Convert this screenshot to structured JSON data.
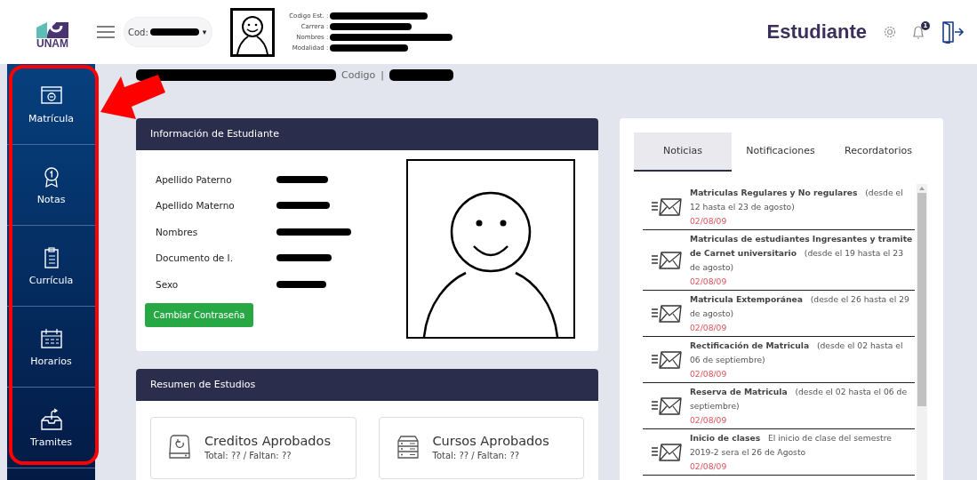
{
  "header": {
    "logo_text": "UNAM",
    "cod_label": "Cod:",
    "cod_caret": "▾",
    "student_fields": [
      "Codigo Est. :",
      "Carrera :",
      "Nombres :",
      "Modalidad :"
    ],
    "role": "Estudiante",
    "notification_count": "1"
  },
  "sidebar": {
    "items": [
      {
        "label": "Matrícula"
      },
      {
        "label": "Notas"
      },
      {
        "label": "Currícula"
      },
      {
        "label": "Horarios"
      },
      {
        "label": "Tramites"
      }
    ]
  },
  "breadcrumb": {
    "code_label": "Codigo",
    "separator": "|"
  },
  "student_card": {
    "title": "Información de Estudiante",
    "fields": [
      "Apellido Paterno",
      "Apellido Materno",
      "Nombres",
      "Documento de I.",
      "Sexo"
    ],
    "button": "Cambiar Contraseña"
  },
  "summary_card": {
    "title": "Resumen de Estudios",
    "stats": [
      {
        "title": "Creditos Aprobados",
        "detail": "Total: ?? / Faltan: ??"
      },
      {
        "title": "Cursos Aprobados",
        "detail": "Total: ?? / Faltan: ??"
      }
    ]
  },
  "news_panel": {
    "tabs": [
      {
        "label": "Noticias",
        "selected": true
      },
      {
        "label": "Notificaciones",
        "selected": false
      },
      {
        "label": "Recordatorios",
        "selected": false
      }
    ],
    "items": [
      {
        "title": "Matriculas Regulares y No regulares",
        "detail": "(desde el 12 hasta el 23 de agosto)",
        "date": "02/08/09"
      },
      {
        "title": "Matriculas de estudiantes Ingresantes y tramite de Carnet universitario",
        "detail": "(desde el 19 hasta el 23 de agosto)",
        "date": "02/08/09"
      },
      {
        "title": "Matricula Extemporánea",
        "detail": "(desde el 26 hasta el 29 de agosto)",
        "date": "02/08/09"
      },
      {
        "title": "Rectificación de Matricula",
        "detail": "(desde el 02 hasta el 06 de septiembre)",
        "date": "02/08/09"
      },
      {
        "title": "Reserva de Matricula",
        "detail": "(desde el 02 hasta el 06 de septiembre)",
        "date": "02/08/09"
      },
      {
        "title": "Inicio de clases",
        "detail": "El inicio de clase del semestre 2019-2 sera el 26 de Agosto",
        "date": "02/08/09"
      }
    ]
  }
}
